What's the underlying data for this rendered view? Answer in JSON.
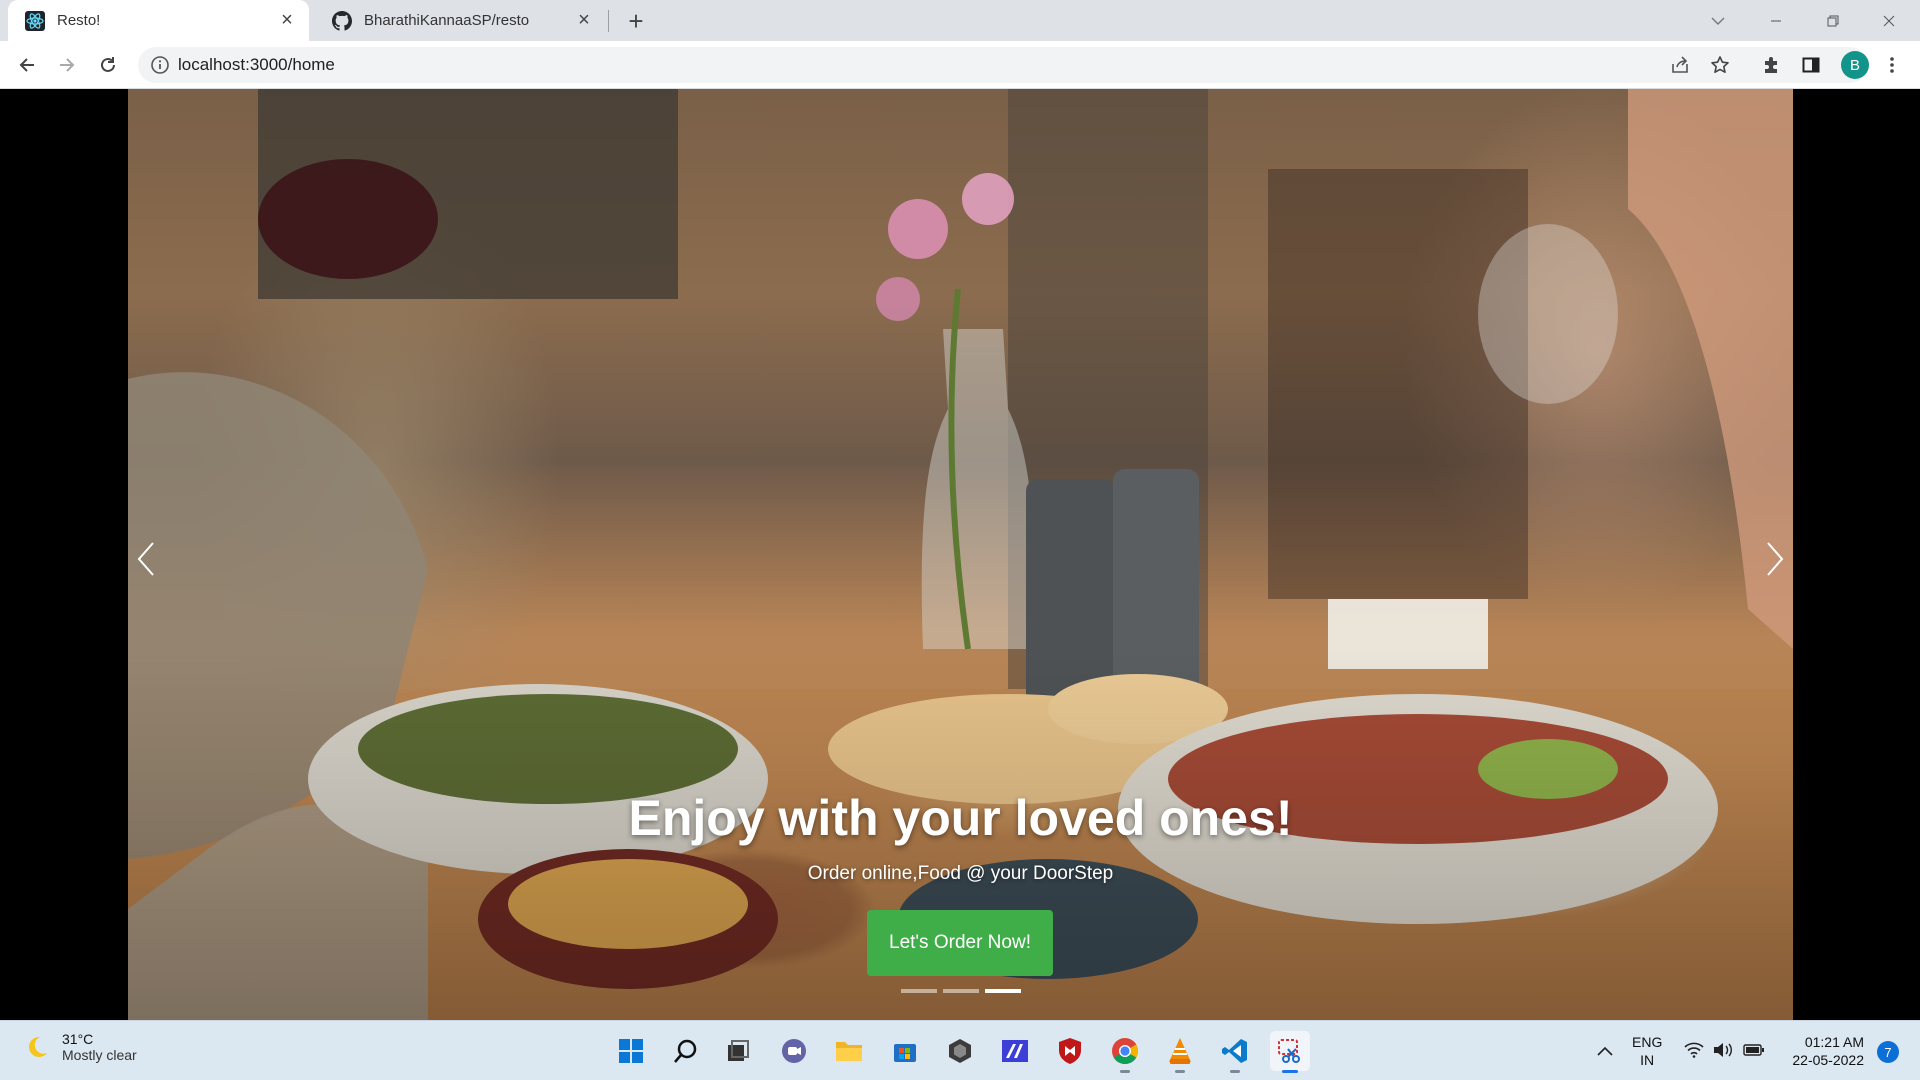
{
  "browser": {
    "tabs": [
      {
        "title": "Resto!",
        "icon": "react-logo-icon",
        "active": true
      },
      {
        "title": "BharathiKannaaSP/resto",
        "icon": "github-icon",
        "active": false
      }
    ],
    "url": "localhost:3000/home"
  },
  "profile": {
    "initial": "B",
    "color": "#12948b"
  },
  "hero": {
    "title": "Enjoy with your loved ones!",
    "subtitle": "Order online,Food @ your DoorStep",
    "cta_label": "Let's Order Now!",
    "cta_color": "#3fae49",
    "slide_count": 3,
    "active_slide": 3
  },
  "taskbar": {
    "weather": {
      "temp": "31°C",
      "condition": "Mostly clear"
    },
    "apps": [
      "start-icon",
      "search-icon",
      "task-view-icon",
      "chat-icon",
      "file-explorer-icon",
      "microsoft-store-icon",
      "app-icon",
      "app-icon",
      "mcafee-icon",
      "chrome-icon",
      "vlc-icon",
      "vscode-icon",
      "snipping-tool-icon"
    ],
    "lang": {
      "line1": "ENG",
      "line2": "IN"
    },
    "time": "01:21 AM",
    "date": "22-05-2022",
    "notifications": "7"
  }
}
